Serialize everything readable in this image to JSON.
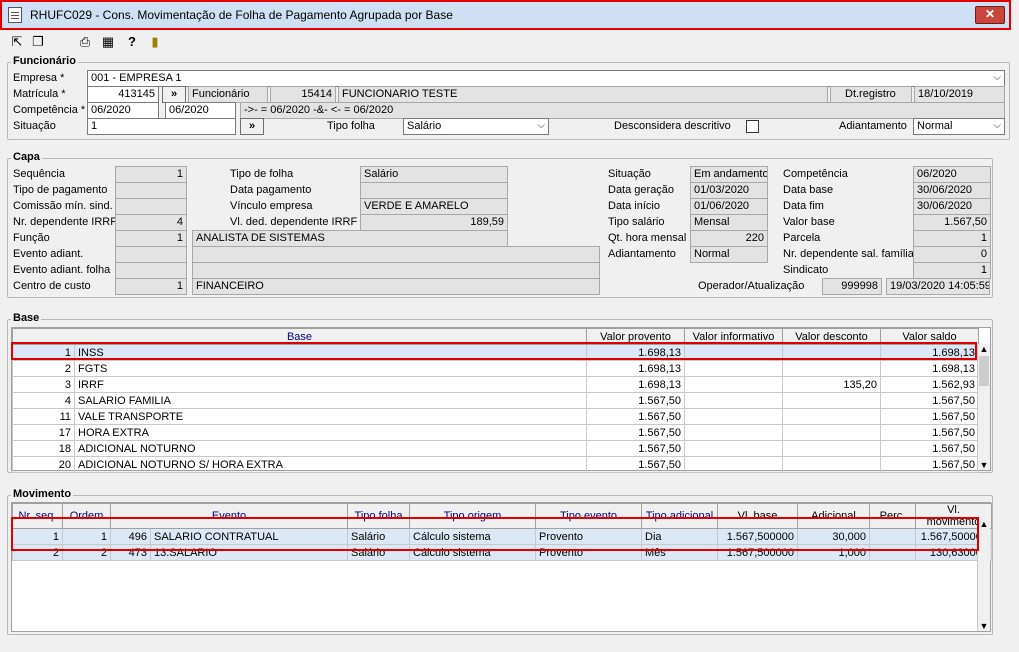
{
  "window": {
    "title": "RHUFC029 - Cons. Movimentação de Folha de Pagamento Agrupada por Base",
    "close": "✕"
  },
  "toolbar": {
    "icons": [
      "first-icon",
      "copy-icon",
      "print-icon",
      "grid-icon",
      "help-icon",
      "exit-icon"
    ]
  },
  "funcionario": {
    "title": "Funcionário",
    "empresa_label": "Empresa *",
    "empresa_value": "001 - EMPRESA 1",
    "matricula_label": "Matrícula *",
    "matricula_value": "413145",
    "nav_button": "»",
    "funcionario_label": "Funcionário",
    "funcionario_code": "15414",
    "funcionario_name": "FUNCIONARIO TESTE",
    "dtregistro_label": "Dt.registro",
    "dtregistro_value": "18/10/2019",
    "competencia_label": "Competência *",
    "competencia_from": "06/2020",
    "competencia_to": "06/2020",
    "competencia_filter": "->- = 06/2020  -&- <- = 06/2020",
    "situacao_label": "Situação",
    "situacao_value": "1",
    "tipo_folha_label": "Tipo folha",
    "tipo_folha_value": "Salário",
    "desconsidera_label": "Desconsidera descritivo",
    "adiantamento_label": "Adiantamento",
    "adiantamento_value": "Normal"
  },
  "capa": {
    "title": "Capa",
    "sequencia_label": "Sequência",
    "sequencia": "1",
    "tipo_pagamento_label": "Tipo de pagamento",
    "tipo_pagamento": "",
    "comissao_label": "Comissão mín. sind.",
    "comissao": "",
    "nr_dep_irrf_label": "Nr. dependente IRRF",
    "nr_dep_irrf": "4",
    "funcao_label": "Função",
    "funcao_code": "1",
    "funcao_name": "ANALISTA DE SISTEMAS",
    "evento_adiant_label": "Evento adiant.",
    "evento_adiant": "",
    "evento_adiant_folha_label": "Evento adiant. folha",
    "evento_adiant_folha": "",
    "centro_custo_label": "Centro de custo",
    "centro_custo_code": "1",
    "centro_custo_name": "FINANCEIRO",
    "tipo_folha_label": "Tipo de folha",
    "tipo_folha": "Salário",
    "data_pagamento_label": "Data pagamento",
    "data_pagamento": "",
    "vinculo_label": "Vínculo empresa",
    "vinculo": "VERDE E AMARELO",
    "vl_ded_label": "Vl. ded. dependente IRRF",
    "vl_ded": "189,59",
    "situacao_label": "Situação",
    "situacao": "Em andamento",
    "data_geracao_label": "Data geração",
    "data_geracao": "01/03/2020",
    "data_inicio_label": "Data início",
    "data_inicio": "01/06/2020",
    "tipo_salario_label": "Tipo salário",
    "tipo_salario": "Mensal",
    "qt_hora_label": "Qt. hora mensal",
    "qt_hora": "220",
    "adiantamento_label": "Adiantamento",
    "adiantamento": "Normal",
    "competencia_label": "Competência",
    "competencia": "06/2020",
    "data_base_label": "Data base",
    "data_base": "30/06/2020",
    "data_fim_label": "Data fim",
    "data_fim": "30/06/2020",
    "valor_base_label": "Valor base",
    "valor_base": "1.567,50",
    "parcela_label": "Parcela",
    "parcela": "1",
    "nr_dep_sal_label": "Nr. dependente sal. família",
    "nr_dep_sal": "0",
    "sindicato_label": "Sindicato",
    "sindicato": "1",
    "operador_label": "Operador/Atualização",
    "operador": "999998",
    "atualizacao": "19/03/2020 14:05:59"
  },
  "base": {
    "title": "Base",
    "columns": [
      "Base",
      "Valor provento",
      "Valor informativo",
      "Valor desconto",
      "Valor saldo"
    ],
    "rows": [
      {
        "code": "1",
        "name": "INSS",
        "provento": "1.698,13",
        "informativo": "",
        "desconto": "",
        "saldo": "1.698,13"
      },
      {
        "code": "2",
        "name": "FGTS",
        "provento": "1.698,13",
        "informativo": "",
        "desconto": "",
        "saldo": "1.698,13"
      },
      {
        "code": "3",
        "name": "IRRF",
        "provento": "1.698,13",
        "informativo": "",
        "desconto": "135,20",
        "saldo": "1.562,93"
      },
      {
        "code": "4",
        "name": "SALARIO FAMILIA",
        "provento": "1.567,50",
        "informativo": "",
        "desconto": "",
        "saldo": "1.567,50"
      },
      {
        "code": "11",
        "name": "VALE TRANSPORTE",
        "provento": "1.567,50",
        "informativo": "",
        "desconto": "",
        "saldo": "1.567,50"
      },
      {
        "code": "17",
        "name": "HORA EXTRA",
        "provento": "1.567,50",
        "informativo": "",
        "desconto": "",
        "saldo": "1.567,50"
      },
      {
        "code": "18",
        "name": "ADICIONAL NOTURNO",
        "provento": "1.567,50",
        "informativo": "",
        "desconto": "",
        "saldo": "1.567,50"
      },
      {
        "code": "20",
        "name": "ADICIONAL NOTURNO S/ HORA EXTRA",
        "provento": "1.567,50",
        "informativo": "",
        "desconto": "",
        "saldo": "1.567,50"
      }
    ]
  },
  "movimento": {
    "title": "Movimento",
    "columns": [
      "Nr. seq.",
      "Ordem",
      "Evento",
      "Tipo folha",
      "Tipo origem",
      "Tipo evento",
      "Tipo adicional",
      "Vl. base",
      "Adicional",
      "Perc.",
      "Vl. movimento"
    ],
    "rows": [
      {
        "seq": "1",
        "ordem": "1",
        "evento_code": "496",
        "evento_name": "SALARIO CONTRATUAL",
        "tipo_folha": "Salário",
        "tipo_origem": "Cálculo sistema",
        "tipo_evento": "Provento",
        "tipo_adicional": "Dia",
        "vl_base": "1.567,500000",
        "adicional": "30,000",
        "perc": "",
        "vl_movimento": "1.567,500000"
      },
      {
        "seq": "2",
        "ordem": "2",
        "evento_code": "473",
        "evento_name": "13.SALARIO",
        "tipo_folha": "Salário",
        "tipo_origem": "Cálculo sistema",
        "tipo_evento": "Provento",
        "tipo_adicional": "Mês",
        "vl_base": "1.567,500000",
        "adicional": "1,000",
        "perc": "",
        "vl_movimento": "130,630000"
      }
    ]
  }
}
